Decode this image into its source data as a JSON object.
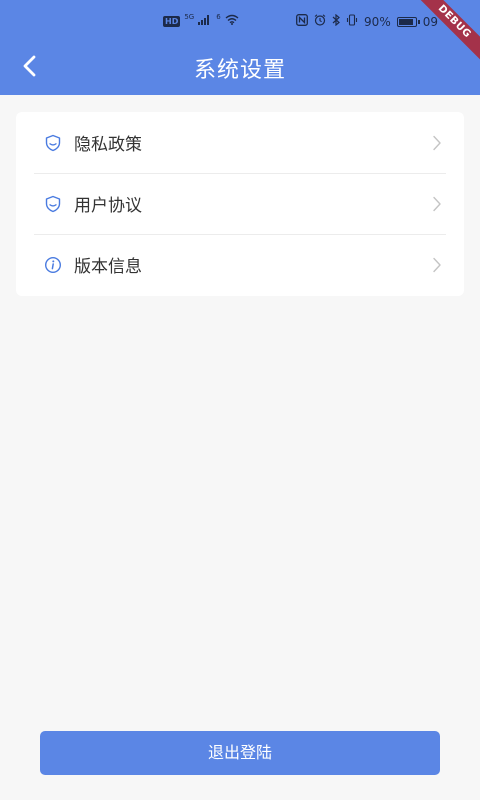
{
  "status_bar": {
    "hd": "HD",
    "signal_label": "5G",
    "wifi_label": "6",
    "battery_percent": "90%",
    "battery_level": 0.9,
    "time": "09",
    "icons": [
      "nfc-icon",
      "alarm-icon",
      "bluetooth-icon",
      "vibrate-icon"
    ]
  },
  "app_bar": {
    "title": "系统设置",
    "background": "#5b86e5"
  },
  "debug_banner": "DEBUG",
  "settings": {
    "items": [
      {
        "label": "隐私政策",
        "icon": "shield-icon"
      },
      {
        "label": "用户协议",
        "icon": "shield-icon"
      },
      {
        "label": "版本信息",
        "icon": "info-icon"
      }
    ]
  },
  "logout": {
    "label": "退出登陆"
  },
  "colors": {
    "accent": "#5b86e5",
    "icon_blue": "#4a7be0",
    "debug_ribbon": "#a4324a",
    "page_bg": "#f7f7f7"
  }
}
